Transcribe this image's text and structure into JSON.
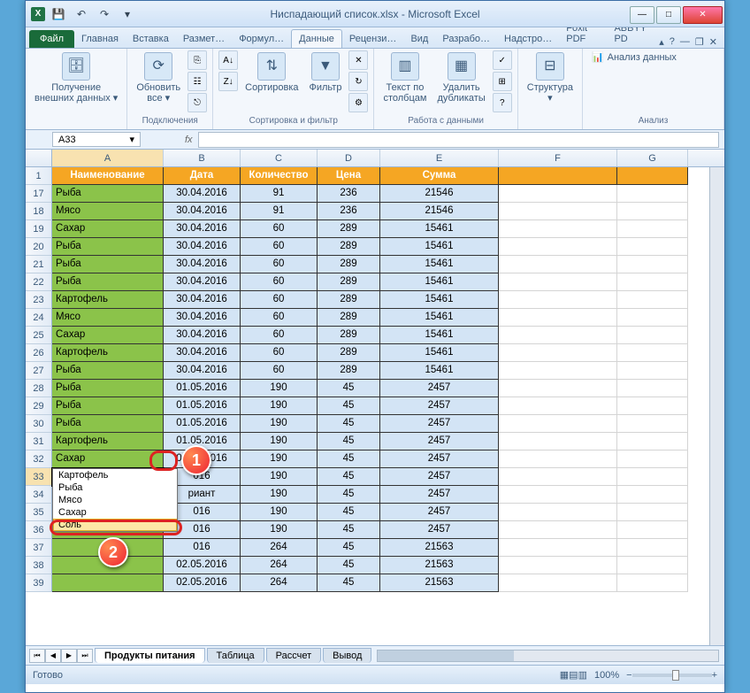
{
  "window": {
    "title": "Ниспадающий список.xlsx - Microsoft Excel"
  },
  "qat": {
    "excel": "X",
    "save": "💾",
    "undo": "↶",
    "redo": "↷",
    "dd": "▾"
  },
  "tabs": {
    "file": "Файл",
    "items": [
      "Главная",
      "Вставка",
      "Размет…",
      "Формул…",
      "Данные",
      "Рецензи…",
      "Вид",
      "Разрабо…",
      "Надстро…",
      "Foxit PDF",
      "ABBYY PD"
    ],
    "active_index": 4,
    "help": "?"
  },
  "ribbon": {
    "g1": {
      "btn": "Получение\nвнешних данных ▾",
      "label": ""
    },
    "g2": {
      "btn": "Обновить\nвсе ▾",
      "label": "Подключения"
    },
    "g3": {
      "sort": "Сортировка",
      "filter": "Фильтр",
      "label": "Сортировка и фильтр"
    },
    "g4": {
      "btn1": "Текст по\nстолбцам",
      "btn2": "Удалить\nдубликаты",
      "label": "Работа с данными"
    },
    "g5": {
      "btn": "Структура\n▾",
      "label": ""
    },
    "g6": {
      "btn": "Анализ данных",
      "label": "Анализ"
    }
  },
  "namebox": {
    "ref": "A33",
    "fx": "fx"
  },
  "columns": [
    "A",
    "B",
    "C",
    "D",
    "E",
    "F",
    "G"
  ],
  "headers": [
    "Наименование",
    "Дата",
    "Количество",
    "Цена",
    "Сумма"
  ],
  "rows": [
    {
      "n": 17,
      "a": "Рыба",
      "b": "30.04.2016",
      "c": "91",
      "d": "236",
      "e": "21546"
    },
    {
      "n": 18,
      "a": "Мясо",
      "b": "30.04.2016",
      "c": "91",
      "d": "236",
      "e": "21546"
    },
    {
      "n": 19,
      "a": "Сахар",
      "b": "30.04.2016",
      "c": "60",
      "d": "289",
      "e": "15461"
    },
    {
      "n": 20,
      "a": "Рыба",
      "b": "30.04.2016",
      "c": "60",
      "d": "289",
      "e": "15461"
    },
    {
      "n": 21,
      "a": "Рыба",
      "b": "30.04.2016",
      "c": "60",
      "d": "289",
      "e": "15461"
    },
    {
      "n": 22,
      "a": "Рыба",
      "b": "30.04.2016",
      "c": "60",
      "d": "289",
      "e": "15461"
    },
    {
      "n": 23,
      "a": "Картофель",
      "b": "30.04.2016",
      "c": "60",
      "d": "289",
      "e": "15461"
    },
    {
      "n": 24,
      "a": "Мясо",
      "b": "30.04.2016",
      "c": "60",
      "d": "289",
      "e": "15461"
    },
    {
      "n": 25,
      "a": "Сахар",
      "b": "30.04.2016",
      "c": "60",
      "d": "289",
      "e": "15461"
    },
    {
      "n": 26,
      "a": "Картофель",
      "b": "30.04.2016",
      "c": "60",
      "d": "289",
      "e": "15461"
    },
    {
      "n": 27,
      "a": "Рыба",
      "b": "30.04.2016",
      "c": "60",
      "d": "289",
      "e": "15461"
    },
    {
      "n": 28,
      "a": "Рыба",
      "b": "01.05.2016",
      "c": "190",
      "d": "45",
      "e": "2457"
    },
    {
      "n": 29,
      "a": "Рыба",
      "b": "01.05.2016",
      "c": "190",
      "d": "45",
      "e": "2457"
    },
    {
      "n": 30,
      "a": "Рыба",
      "b": "01.05.2016",
      "c": "190",
      "d": "45",
      "e": "2457"
    },
    {
      "n": 31,
      "a": "Картофель",
      "b": "01.05.2016",
      "c": "190",
      "d": "45",
      "e": "2457"
    },
    {
      "n": 32,
      "a": "Сахар",
      "b": "01.05.2016",
      "c": "190",
      "d": "45",
      "e": "2457"
    },
    {
      "n": 33,
      "a": "",
      "b": "016",
      "c": "190",
      "d": "45",
      "e": "2457"
    },
    {
      "n": 34,
      "a": "",
      "b": "риант",
      "c": "190",
      "d": "45",
      "e": "2457"
    },
    {
      "n": 35,
      "a": "",
      "b": "016",
      "c": "190",
      "d": "45",
      "e": "2457"
    },
    {
      "n": 36,
      "a": "",
      "b": "016",
      "c": "190",
      "d": "45",
      "e": "2457"
    },
    {
      "n": 37,
      "a": "",
      "b": "016",
      "c": "264",
      "d": "45",
      "e": "21563"
    },
    {
      "n": 38,
      "a": "",
      "b": "02.05.2016",
      "c": "264",
      "d": "45",
      "e": "21563"
    },
    {
      "n": 39,
      "a": "",
      "b": "02.05.2016",
      "c": "264",
      "d": "45",
      "e": "21563"
    }
  ],
  "dropdown": {
    "items": [
      "Картофель",
      "Рыба",
      "Мясо",
      "Сахар",
      "Соль"
    ],
    "hover_index": 4
  },
  "callouts": {
    "one": "1",
    "two": "2"
  },
  "sheets": {
    "nav": [
      "⏮",
      "◀",
      "▶",
      "⏭"
    ],
    "tabs": [
      "Продукты питания",
      "Таблица",
      "Рассчет",
      "Вывод"
    ],
    "active_index": 0
  },
  "status": {
    "ready": "Готово",
    "zoom": "100%",
    "views": [
      "▦",
      "▤",
      "▥"
    ]
  }
}
